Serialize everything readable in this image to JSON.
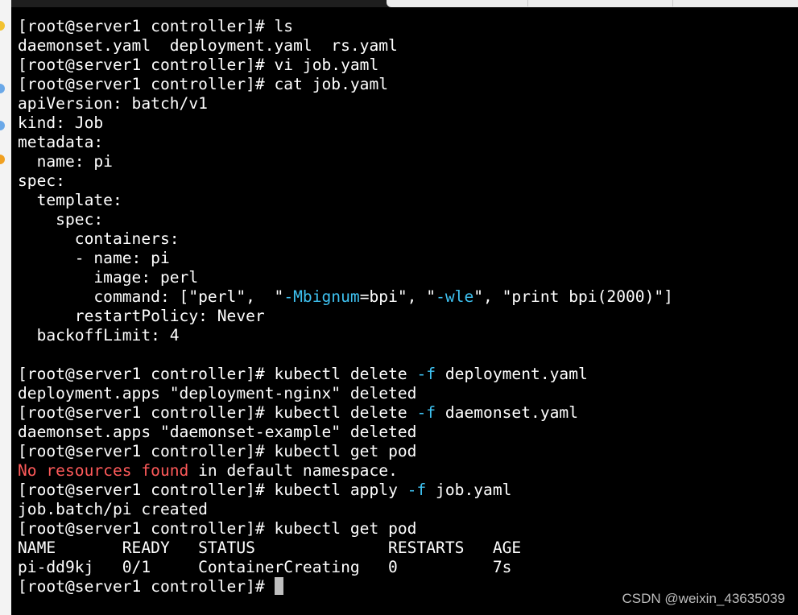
{
  "prompt": "[root@server1 controller]# ",
  "session": [
    {
      "cmd": "ls"
    },
    {
      "out": "daemonset.yaml  deployment.yaml  rs.yaml"
    },
    {
      "cmd": "vi job.yaml"
    },
    {
      "cmd": "cat job.yaml"
    },
    {
      "yaml": "apiVersion: batch/v1"
    },
    {
      "yaml": "kind: Job"
    },
    {
      "yaml": "metadata:"
    },
    {
      "yaml": "  name: pi"
    },
    {
      "yaml": "spec:"
    },
    {
      "yaml": "  template:"
    },
    {
      "yaml": "    spec:"
    },
    {
      "yaml": "      containers:"
    },
    {
      "yaml": "      - name: pi"
    },
    {
      "yaml": "        image: perl"
    },
    {
      "yaml_command": {
        "before": "        command: [\"perl\",  \"",
        "flag1": "-Mbignum",
        "middle": "=bpi\", \"",
        "flag2": "-wle",
        "after": "\", \"print bpi(2000)\"]"
      }
    },
    {
      "yaml": "      restartPolicy: Never"
    },
    {
      "yaml": "  backoffLimit: 4"
    },
    {
      "blank": true
    },
    {
      "cmd_flag": {
        "head": "kubectl delete ",
        "flag": "-f",
        "tail": " deployment.yaml"
      }
    },
    {
      "out": "deployment.apps \"deployment-nginx\" deleted"
    },
    {
      "cmd_flag": {
        "head": "kubectl delete ",
        "flag": "-f",
        "tail": " daemonset.yaml"
      }
    },
    {
      "out": "daemonset.apps \"daemonset-example\" deleted"
    },
    {
      "cmd": "kubectl get pod"
    },
    {
      "err": {
        "red": "No resources found",
        "rest": " in default namespace."
      }
    },
    {
      "cmd_flag": {
        "head": "kubectl apply ",
        "flag": "-f",
        "tail": " job.yaml"
      }
    },
    {
      "out": "job.batch/pi created"
    },
    {
      "cmd": "kubectl get pod"
    },
    {
      "out": "NAME       READY   STATUS              RESTARTS   AGE"
    },
    {
      "out": "pi-dd9kj   0/1     ContainerCreating   0          7s"
    },
    {
      "prompt_cursor": true
    }
  ],
  "watermark": "CSDN @weixin_43635039",
  "colors": {
    "background": "#000000",
    "text": "#ffffff",
    "flag": "#3ec1f0",
    "error": "#ff5a5a"
  }
}
